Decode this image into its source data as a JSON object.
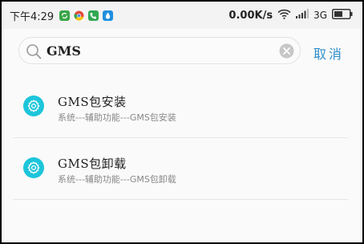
{
  "status_bar": {
    "time": "下午4:29",
    "speed": "0.00K/s",
    "network": "3G",
    "app_icons": [
      {
        "name": "sync-app-icon",
        "color": "#3aa648"
      },
      {
        "name": "chrome-app-icon",
        "color": "#e14b3b"
      },
      {
        "name": "phone-app-icon",
        "color": "#33a852"
      },
      {
        "name": "drop-app-icon",
        "color": "#1f8fe0"
      }
    ]
  },
  "search": {
    "value": "GMS",
    "placeholder": "",
    "cancel_label": "取消"
  },
  "results": [
    {
      "title": "GMS包安装",
      "subtitle": "系统---辅助功能---GMS包安装",
      "icon": "gear-icon"
    },
    {
      "title": "GMS包卸载",
      "subtitle": "系统---辅助功能---GMS包卸载",
      "icon": "gear-icon"
    }
  ],
  "colors": {
    "accent": "#2f8ec9",
    "result_icon_bg": "#1cc5da"
  }
}
